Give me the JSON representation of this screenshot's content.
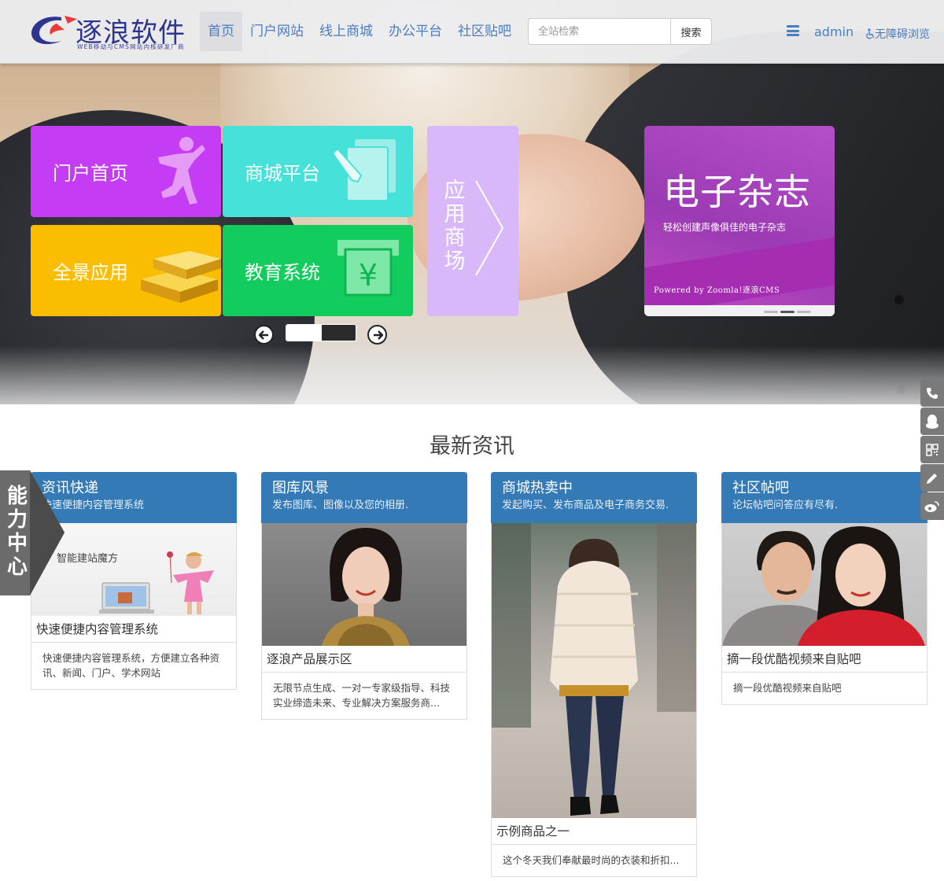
{
  "header": {
    "logo_text": "逐浪软件",
    "logo_sub": "WEB移动与CMS网站内核研发厂商",
    "nav": [
      "首页",
      "门户网站",
      "线上商城",
      "办公平台",
      "社区贴吧"
    ],
    "search_placeholder": "全站检索",
    "search_button": "搜索",
    "user": "admin",
    "accessibility": "无障碍浏览"
  },
  "hero": {
    "tiles": {
      "portal": "门户首页",
      "mall": "商城平台",
      "panorama": "全景应用",
      "education": "教育系统",
      "app_store": [
        "应",
        "用",
        "商",
        "场"
      ]
    },
    "magazine": {
      "title": "电子杂志",
      "subtitle": "轻松创建声像俱佳的电子杂志",
      "powered": "Powered by Zoomla!逐浪CMS"
    }
  },
  "news": {
    "section_title": "最新资讯",
    "cards": [
      {
        "title": "资讯快递",
        "subtitle": "快速便捷内容管理系统",
        "caption": "快速便捷内容管理系统",
        "description": "快速便捷内容管理系统，方便建立各种资讯、新闻、门户、学术网站",
        "image_text": "智能建站魔方"
      },
      {
        "title": "图库风景",
        "subtitle": "发布图库、图像以及您的相册.",
        "caption": "逐浪产品展示区",
        "description": "无限节点生成、一对一专家级指导、科技实业缔造未来、专业解决方案服务商..."
      },
      {
        "title": "商城热卖中",
        "subtitle": "发起购买、发布商品及电子商务交易.",
        "caption": "示例商品之一",
        "description": "这个冬天我们奉献最时尚的衣装和折扣..."
      },
      {
        "title": "社区帖吧",
        "subtitle": "论坛帖吧问答应有尽有.",
        "caption": "摘一段优酷视频来自贴吧",
        "description": "摘一段优酷视频来自贴吧"
      }
    ]
  },
  "float_left": {
    "label": "能力中心"
  },
  "float_right": [
    "phone-icon",
    "qq-icon",
    "qrcode-icon",
    "edit-icon",
    "weibo-icon"
  ],
  "colors": {
    "nav_link": "#4a7dbf",
    "card_header": "#337ab7",
    "tile_portal": "#c43cf3",
    "tile_mall": "#46e1d8",
    "tile_panorama": "#fbbd00",
    "tile_education": "#12cc5e",
    "tile_app_store": "#d9b8fa",
    "tile_magazine": "#c93cbf"
  }
}
